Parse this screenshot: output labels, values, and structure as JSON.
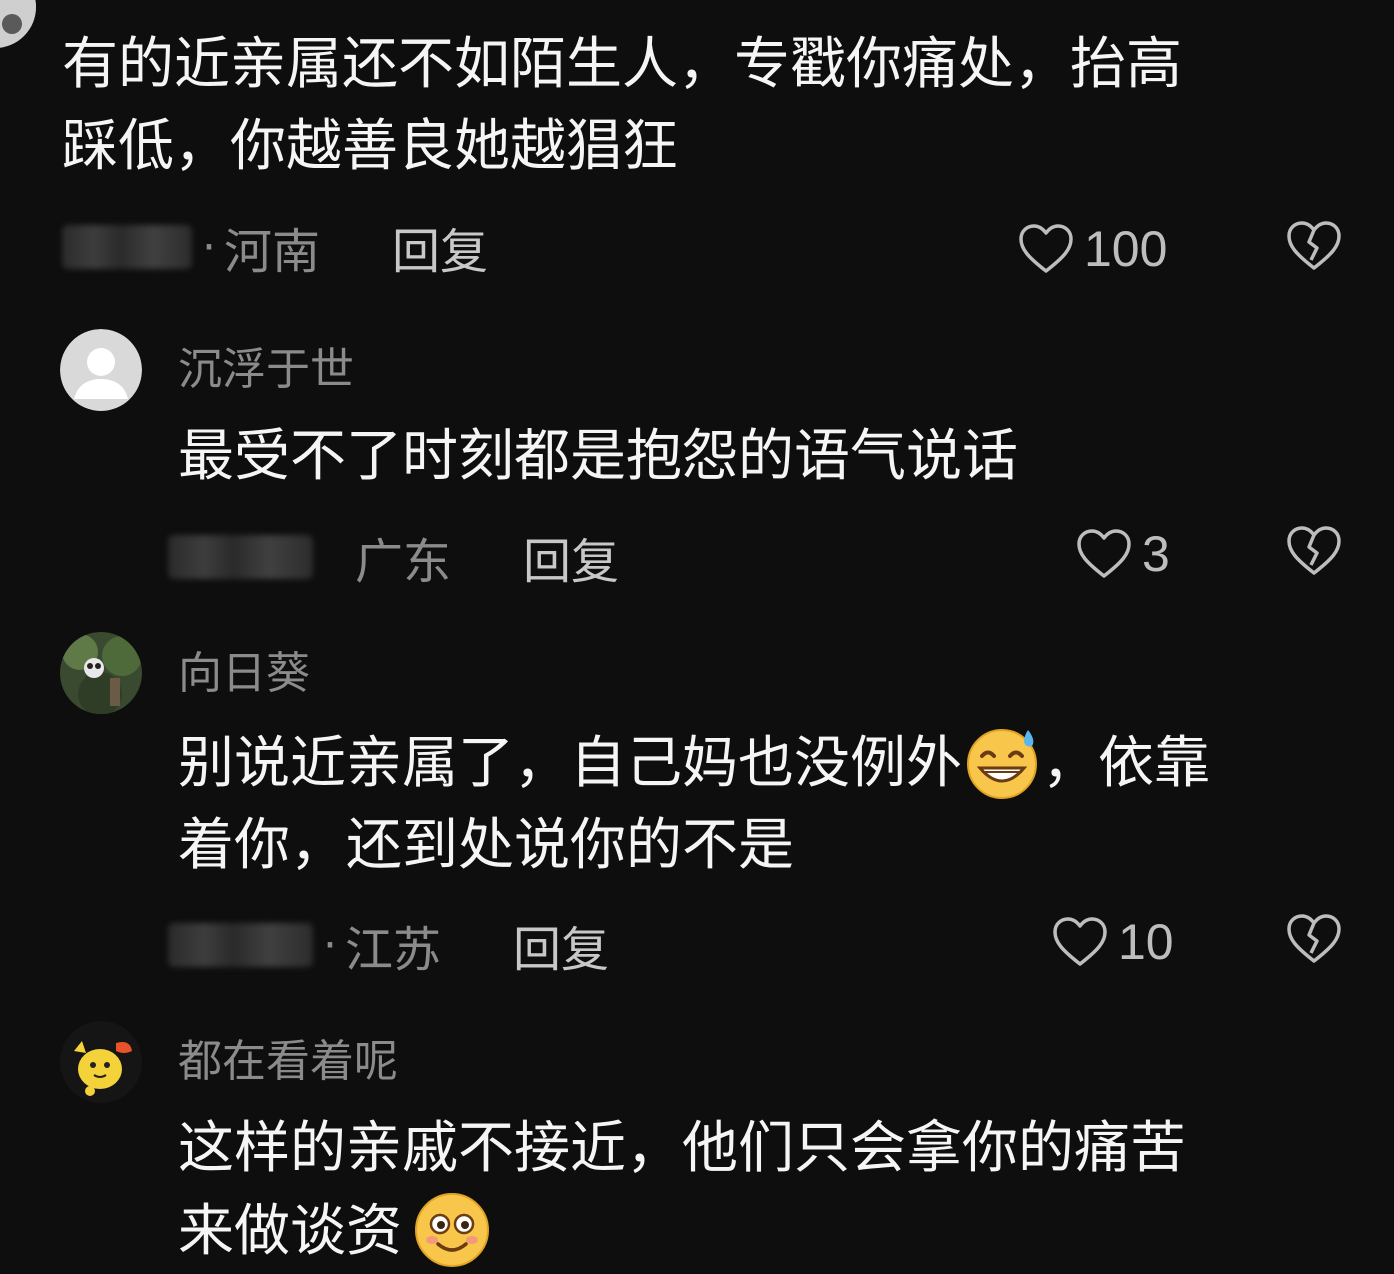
{
  "comments": [
    {
      "username": "",
      "text_lines": [
        "有的近亲属还不如陌生人，专戳你痛处，抬高",
        "踩低，你越善良她越猖狂"
      ],
      "region": "河南",
      "reply": "回复",
      "likes": "100"
    },
    {
      "username": "沉浮于世",
      "text_lines": [
        "最受不了时刻都是抱怨的语气说话"
      ],
      "region": "广东",
      "reply": "回复",
      "likes": "3"
    },
    {
      "username": "向日葵",
      "text_line1_a": "别说近亲属了，自己妈也没例外",
      "text_line1_b": "，依靠",
      "text_line2": "着你，还到处说你的不是",
      "emoji": "grinning-sweat-emoji",
      "region": "江苏",
      "reply": "回复",
      "likes": "10"
    },
    {
      "username": "都在看着呢",
      "text_line1": "这样的亲戚不接近，他们只会拿你的痛苦",
      "text_line2": "来做谈资",
      "emoji": "smiling-face-emoji"
    }
  ],
  "icons": {
    "like": "heart-outline-icon",
    "dislike": "broken-heart-icon"
  },
  "colors": {
    "background": "#0e0e0f",
    "text": "#f5f5f5",
    "secondary": "#8b8b8b"
  }
}
